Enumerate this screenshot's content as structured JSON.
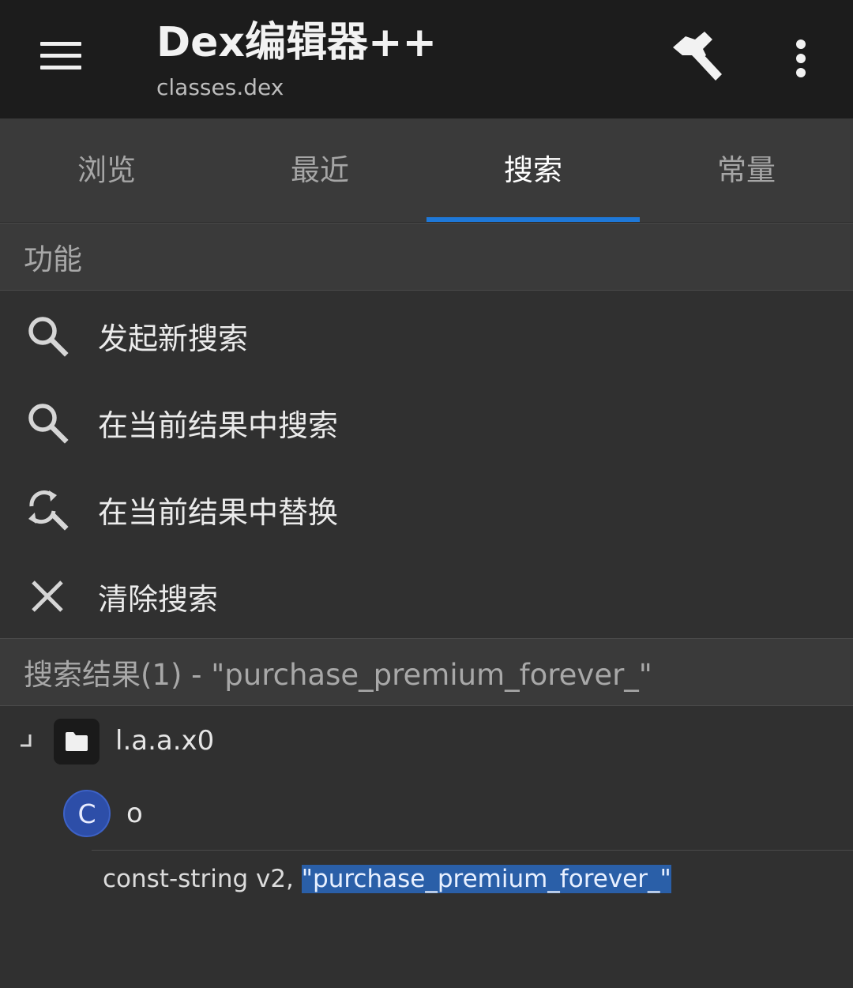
{
  "appbar": {
    "title": "Dex编辑器++",
    "subtitle": "classes.dex",
    "icons": [
      "menu-icon",
      "hammer-icon",
      "more-vert-icon"
    ]
  },
  "tabs": [
    {
      "label": "浏览",
      "active": false
    },
    {
      "label": "最近",
      "active": false
    },
    {
      "label": "搜索",
      "active": true
    },
    {
      "label": "常量",
      "active": false
    }
  ],
  "functions": {
    "header": "功能",
    "items": [
      {
        "label": "发起新搜索",
        "icon": "search-icon"
      },
      {
        "label": "在当前结果中搜索",
        "icon": "search-icon"
      },
      {
        "label": "在当前结果中替换",
        "icon": "find-replace-icon"
      },
      {
        "label": "清除搜索",
        "icon": "close-icon"
      }
    ]
  },
  "results": {
    "header": "搜索结果(1) - \"purchase_premium_forever_\"",
    "package": "l.a.a.x0",
    "class_badge": "C",
    "class_name": "o",
    "code_prefix": "const-string v2, ",
    "code_match": "\"purchase_premium_forever_\""
  },
  "colors": {
    "accent": "#1e78d8",
    "appbar_bg": "#1c1c1c",
    "background": "#303030",
    "class_badge": "#2d4ea8",
    "highlight": "#2a5fa8"
  }
}
